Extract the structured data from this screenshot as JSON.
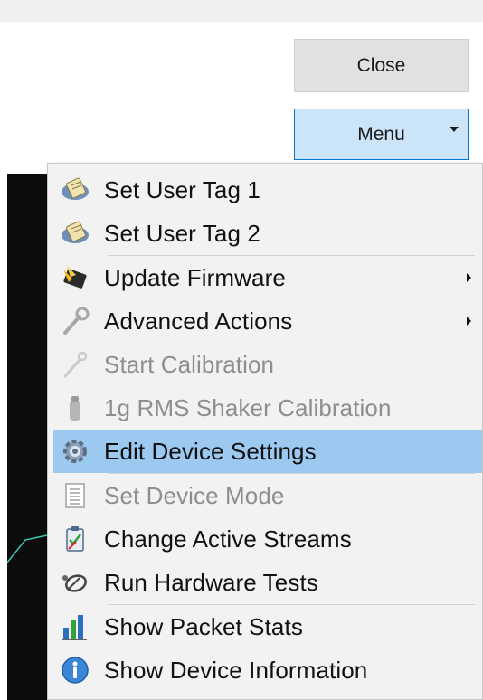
{
  "buttons": {
    "close_label": "Close",
    "menu_label": "Menu"
  },
  "menu": {
    "items": [
      {
        "label": "Set User Tag 1",
        "icon": "tag-icon"
      },
      {
        "label": "Set User Tag 2",
        "icon": "tag-icon"
      },
      {
        "label": "Update Firmware",
        "icon": "chip-icon",
        "submenu": true
      },
      {
        "label": "Advanced Actions",
        "icon": "wrench-icon",
        "submenu": true
      },
      {
        "label": "Start Calibration",
        "icon": "probe-icon",
        "disabled": true
      },
      {
        "label": "1g RMS Shaker Calibration",
        "icon": "shaker-icon",
        "disabled": true
      },
      {
        "label": "Edit Device Settings",
        "icon": "gear-icon",
        "highlighted": true
      },
      {
        "label": "Set Device Mode",
        "icon": "list-icon",
        "disabled": true
      },
      {
        "label": "Change Active Streams",
        "icon": "clipboard-icon"
      },
      {
        "label": "Run Hardware Tests",
        "icon": "stethoscope-icon"
      },
      {
        "label": "Show Packet Stats",
        "icon": "bar-chart-icon"
      },
      {
        "label": "Show Device Information",
        "icon": "info-icon"
      }
    ]
  },
  "colors": {
    "highlight": "#9bc9f0",
    "menu_button_bg": "#cce4f7",
    "disabled_text": "#8e8e8e"
  }
}
